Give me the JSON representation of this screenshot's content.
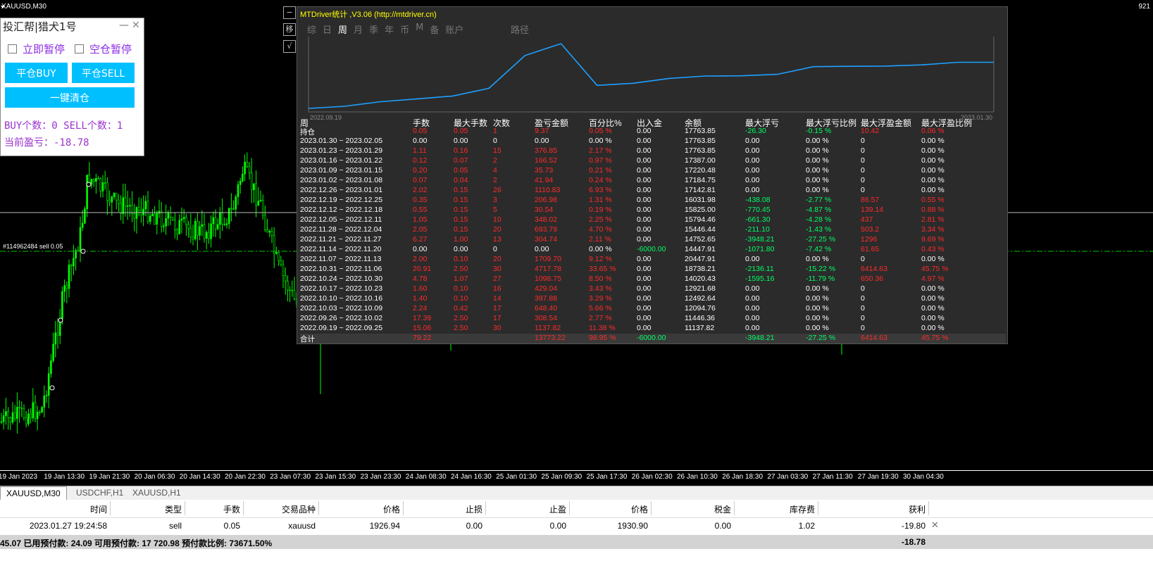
{
  "chart": {
    "symbol_title": "XAUUSD,M30",
    "top_right_price": "921",
    "order_label": "#114962484 sell 0.05",
    "time_labels": [
      "19 Jan 2023",
      "19 Jan 13:30",
      "19 Jan 21:30",
      "20 Jan 06:30",
      "20 Jan 14:30",
      "20 Jan 22:30",
      "23 Jan 07:30",
      "23 Jan 15:30",
      "23 Jan 23:30",
      "24 Jan 08:30",
      "24 Jan 16:30",
      "25 Jan 01:30",
      "25 Jan 09:30",
      "25 Jan 17:30",
      "26 Jan 02:30",
      "26 Jan 10:30",
      "26 Jan 18:30",
      "27 Jan 03:30",
      "27 Jan 11:30",
      "27 Jan 19:30",
      "30 Jan 04:30"
    ],
    "colors": {
      "bull": "#00ff00",
      "bear": "#00ff00",
      "bg": "#000000",
      "line": "#ffffff"
    }
  },
  "panel": {
    "title": "投汇帮|猎犬1号",
    "minimize": "—",
    "close": "✕",
    "pause_now": "立即暂停",
    "flat_pause": "空仓暂停",
    "close_buy": "平仓BUY",
    "close_sell": "平仓SELL",
    "close_all": "一键清仓",
    "buy_count_text": "BUY个数：0  SELL个数：1",
    "pnl_text": "当前盈亏：-18.78"
  },
  "side_icons": [
    "移",
    "√"
  ],
  "stats": {
    "title": "MTDriver统计 ,V3.06 (http://mtdriver.cn)",
    "tabs": [
      "综",
      "日",
      "周",
      "月",
      "季",
      "年",
      "币",
      "M",
      "备",
      "账户"
    ],
    "active_tab": "周",
    "path_label": "路径",
    "mini_chart": {
      "start_label": "2022.09.19",
      "end_label": "2023.01.30",
      "values": [
        11137.82,
        11446.36,
        12094.76,
        12492.64,
        12921.68,
        14020.43,
        18738.21,
        20447.91,
        14447.91,
        14752.65,
        15446.44,
        15794.46,
        15825.0,
        16031.98,
        17142.81,
        17184.75,
        17220.48,
        17387.0,
        17763.85,
        17763.85
      ],
      "color": "#1ea0ff"
    },
    "headers": [
      "周",
      "手数",
      "最大手数",
      "次数",
      "盈亏金额",
      "百分比%",
      "出入金",
      "余额",
      "最大浮亏",
      "最大浮亏比例",
      "最大浮盈金额",
      "最大浮盈比例"
    ],
    "rows": [
      {
        "c": [
          "持仓",
          "0.05",
          "0.05",
          "1",
          "9.37",
          "0.05 %",
          "0.00",
          "17763.85",
          "-26.30",
          "-0.15 %",
          "10.42",
          "0.06 %"
        ],
        "k": [
          "wh",
          "rd",
          "rd",
          "rd",
          "rd",
          "rd",
          "wh",
          "wh",
          "gn",
          "gn",
          "rd",
          "rd"
        ]
      },
      {
        "c": [
          "2023.01.30 ~ 2023.02.05",
          "0.00",
          "0.00",
          "0",
          "0.00",
          "0.00 %",
          "0.00",
          "17763.85",
          "0.00",
          "0.00 %",
          "0",
          "0.00 %"
        ],
        "k": [
          "wh",
          "wh",
          "wh",
          "wh",
          "wh",
          "wh",
          "wh",
          "wh",
          "wh",
          "wh",
          "wh",
          "wh"
        ]
      },
      {
        "c": [
          "2023.01.23 ~ 2023.01.29",
          "1.11",
          "0.16",
          "15",
          "376.85",
          "2.17 %",
          "0.00",
          "17763.85",
          "0.00",
          "0.00 %",
          "0",
          "0.00 %"
        ],
        "k": [
          "wh",
          "rd",
          "rd",
          "rd",
          "rd",
          "rd",
          "wh",
          "wh",
          "wh",
          "wh",
          "wh",
          "wh"
        ]
      },
      {
        "c": [
          "2023.01.16 ~ 2023.01.22",
          "0.12",
          "0.07",
          "2",
          "166.52",
          "0.97 %",
          "0.00",
          "17387.00",
          "0.00",
          "0.00 %",
          "0",
          "0.00 %"
        ],
        "k": [
          "wh",
          "rd",
          "rd",
          "rd",
          "rd",
          "rd",
          "wh",
          "wh",
          "wh",
          "wh",
          "wh",
          "wh"
        ]
      },
      {
        "c": [
          "2023.01.09 ~ 2023.01.15",
          "0.20",
          "0.05",
          "4",
          "35.73",
          "0.21 %",
          "0.00",
          "17220.48",
          "0.00",
          "0.00 %",
          "0",
          "0.00 %"
        ],
        "k": [
          "wh",
          "rd",
          "rd",
          "rd",
          "rd",
          "rd",
          "wh",
          "wh",
          "wh",
          "wh",
          "wh",
          "wh"
        ]
      },
      {
        "c": [
          "2023.01.02 ~ 2023.01.08",
          "0.07",
          "0.04",
          "2",
          "41.94",
          "0.24 %",
          "0.00",
          "17184.75",
          "0.00",
          "0.00 %",
          "0",
          "0.00 %"
        ],
        "k": [
          "wh",
          "rd",
          "rd",
          "rd",
          "rd",
          "rd",
          "wh",
          "wh",
          "wh",
          "wh",
          "wh",
          "wh"
        ]
      },
      {
        "c": [
          "2022.12.26 ~ 2023.01.01",
          "2.02",
          "0.15",
          "26",
          "1110.83",
          "6.93 %",
          "0.00",
          "17142.81",
          "0.00",
          "0.00 %",
          "0",
          "0.00 %"
        ],
        "k": [
          "wh",
          "rd",
          "rd",
          "rd",
          "rd",
          "rd",
          "wh",
          "wh",
          "wh",
          "wh",
          "wh",
          "wh"
        ]
      },
      {
        "c": [
          "2022.12.19 ~ 2022.12.25",
          "0.35",
          "0.15",
          "3",
          "206.98",
          "1.31 %",
          "0.00",
          "16031.98",
          "-438.08",
          "-2.77 %",
          "86.57",
          "0.55 %"
        ],
        "k": [
          "wh",
          "rd",
          "rd",
          "rd",
          "rd",
          "rd",
          "wh",
          "wh",
          "gn",
          "gn",
          "rd",
          "rd"
        ]
      },
      {
        "c": [
          "2022.12.12 ~ 2022.12.18",
          "0.55",
          "0.15",
          "5",
          "30.54",
          "0.19 %",
          "0.00",
          "15825.00",
          "-770.45",
          "-4.87 %",
          "139.14",
          "0.88 %"
        ],
        "k": [
          "wh",
          "rd",
          "rd",
          "rd",
          "rd",
          "rd",
          "wh",
          "wh",
          "gn",
          "gn",
          "rd",
          "rd"
        ]
      },
      {
        "c": [
          "2022.12.05 ~ 2022.12.11",
          "1.05",
          "0.15",
          "10",
          "348.02",
          "2.25 %",
          "0.00",
          "15794.46",
          "-661.30",
          "-4.28 %",
          "437",
          "2.81 %"
        ],
        "k": [
          "wh",
          "rd",
          "rd",
          "rd",
          "rd",
          "rd",
          "wh",
          "wh",
          "gn",
          "gn",
          "rd",
          "rd"
        ]
      },
      {
        "c": [
          "2022.11.28 ~ 2022.12.04",
          "2.05",
          "0.15",
          "20",
          "693.79",
          "4.70 %",
          "0.00",
          "15446.44",
          "-211.10",
          "-1.43 %",
          "503.2",
          "3.34 %"
        ],
        "k": [
          "wh",
          "rd",
          "rd",
          "rd",
          "rd",
          "rd",
          "wh",
          "wh",
          "gn",
          "gn",
          "rd",
          "rd"
        ]
      },
      {
        "c": [
          "2022.11.21 ~ 2022.11.27",
          "6.27",
          "1.00",
          "13",
          "304.74",
          "2.11 %",
          "0.00",
          "14752.65",
          "-3948.21",
          "-27.25 %",
          "1296",
          "9.69 %"
        ],
        "k": [
          "wh",
          "rd",
          "rd",
          "rd",
          "rd",
          "rd",
          "wh",
          "wh",
          "gn",
          "gn",
          "rd",
          "rd"
        ]
      },
      {
        "c": [
          "2022.11.14 ~ 2022.11.20",
          "0.00",
          "0.00",
          "0",
          "0.00",
          "0.00 %",
          "-6000.00",
          "14447.91",
          "-1071.80",
          "-7.42 %",
          "61.65",
          "0.43 %"
        ],
        "k": [
          "wh",
          "wh",
          "wh",
          "wh",
          "wh",
          "wh",
          "gn",
          "wh",
          "gn",
          "gn",
          "rd",
          "rd"
        ]
      },
      {
        "c": [
          "2022.11.07 ~ 2022.11.13",
          "2.00",
          "0.10",
          "20",
          "1709.70",
          "9.12 %",
          "0.00",
          "20447.91",
          "0.00",
          "0.00 %",
          "0",
          "0.00 %"
        ],
        "k": [
          "wh",
          "rd",
          "rd",
          "rd",
          "rd",
          "rd",
          "wh",
          "wh",
          "wh",
          "wh",
          "wh",
          "wh"
        ]
      },
      {
        "c": [
          "2022.10.31 ~ 2022.11.06",
          "20.91",
          "2.50",
          "30",
          "4717.78",
          "33.65 %",
          "0.00",
          "18738.21",
          "-2136.11",
          "-15.22 %",
          "6414.63",
          "45.75 %"
        ],
        "k": [
          "wh",
          "rd",
          "rd",
          "rd",
          "rd",
          "rd",
          "wh",
          "wh",
          "gn",
          "gn",
          "rd",
          "rd"
        ]
      },
      {
        "c": [
          "2022.10.24 ~ 2022.10.30",
          "4.78",
          "1.07",
          "27",
          "1098.75",
          "8.50 %",
          "0.00",
          "14020.43",
          "-1595.16",
          "-11.79 %",
          "650.36",
          "4.97 %"
        ],
        "k": [
          "wh",
          "rd",
          "rd",
          "rd",
          "rd",
          "rd",
          "wh",
          "wh",
          "gn",
          "gn",
          "rd",
          "rd"
        ]
      },
      {
        "c": [
          "2022.10.17 ~ 2022.10.23",
          "1.60",
          "0.10",
          "16",
          "429.04",
          "3.43 %",
          "0.00",
          "12921.68",
          "0.00",
          "0.00 %",
          "0",
          "0.00 %"
        ],
        "k": [
          "wh",
          "rd",
          "rd",
          "rd",
          "rd",
          "rd",
          "wh",
          "wh",
          "wh",
          "wh",
          "wh",
          "wh"
        ]
      },
      {
        "c": [
          "2022.10.10 ~ 2022.10.16",
          "1.40",
          "0.10",
          "14",
          "397.88",
          "3.29 %",
          "0.00",
          "12492.64",
          "0.00",
          "0.00 %",
          "0",
          "0.00 %"
        ],
        "k": [
          "wh",
          "rd",
          "rd",
          "rd",
          "rd",
          "rd",
          "wh",
          "wh",
          "wh",
          "wh",
          "wh",
          "wh"
        ]
      },
      {
        "c": [
          "2022.10.03 ~ 2022.10.09",
          "2.24",
          "0.42",
          "17",
          "648.40",
          "5.66 %",
          "0.00",
          "12094.76",
          "0.00",
          "0.00 %",
          "0",
          "0.00 %"
        ],
        "k": [
          "wh",
          "rd",
          "rd",
          "rd",
          "rd",
          "rd",
          "wh",
          "wh",
          "wh",
          "wh",
          "wh",
          "wh"
        ]
      },
      {
        "c": [
          "2022.09.26 ~ 2022.10.02",
          "17.39",
          "2.50",
          "17",
          "308.54",
          "2.77 %",
          "0.00",
          "11446.36",
          "0.00",
          "0.00 %",
          "0",
          "0.00 %"
        ],
        "k": [
          "wh",
          "rd",
          "rd",
          "rd",
          "rd",
          "rd",
          "wh",
          "wh",
          "wh",
          "wh",
          "wh",
          "wh"
        ]
      },
      {
        "c": [
          "2022.09.19 ~ 2022.09.25",
          "15.06",
          "2.50",
          "30",
          "1137.82",
          "11.38 %",
          "0.00",
          "11137.82",
          "0.00",
          "0.00 %",
          "0",
          "0.00 %"
        ],
        "k": [
          "wh",
          "rd",
          "rd",
          "rd",
          "rd",
          "rd",
          "wh",
          "wh",
          "wh",
          "wh",
          "wh",
          "wh"
        ]
      }
    ],
    "total": {
      "c": [
        "合计",
        "79.22",
        "",
        "",
        "13773.22",
        "98.95 %",
        "-6000.00",
        "",
        "-3948.21",
        "-27.25 %",
        "6414.63",
        "45.75 %"
      ],
      "k": [
        "wh",
        "rd",
        "rd",
        "rd",
        "rd",
        "rd",
        "gn",
        "wh",
        "gn",
        "gn",
        "rd",
        "rd"
      ]
    }
  },
  "bottom_tabs": [
    "XAUUSD,M30",
    "USDCHF,H1",
    "XAUUSD,H1"
  ],
  "terminal": {
    "headers": [
      "时间",
      "类型",
      "手数",
      "交易品种",
      "价格",
      "止损",
      "止盈",
      "价格",
      "税金",
      "库存费",
      "获利"
    ],
    "row": [
      "2023.01.27 19:24:58",
      "sell",
      "0.05",
      "xauusd",
      "1926.94",
      "0.00",
      "0.00",
      "1930.90",
      "0.00",
      "1.02",
      "-19.80"
    ],
    "close_icon": "✕",
    "summary_text": "45.07  已用预付款: 24.09  可用预付款: 17 720.98  预付款比例: 73671.50%",
    "summary_profit": "-18.78"
  }
}
